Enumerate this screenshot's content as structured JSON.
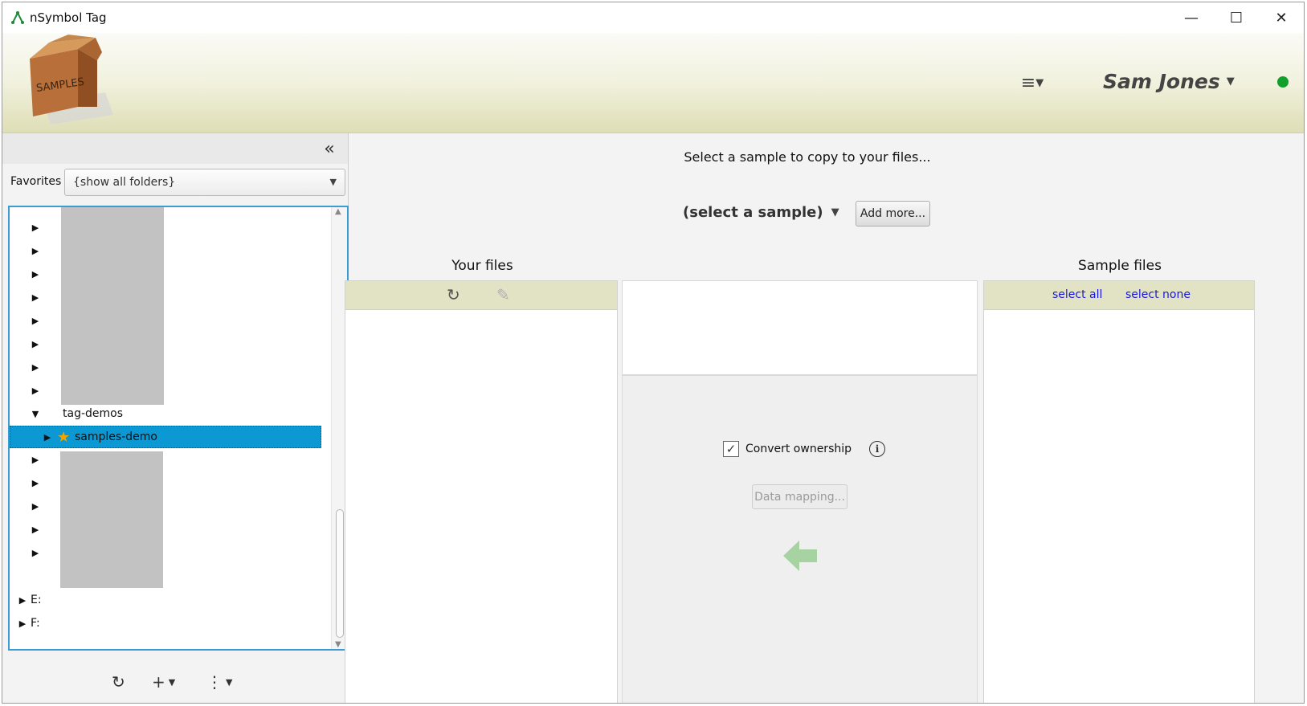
{
  "window": {
    "title": "nSymbol Tag",
    "minimize_glyph": "—",
    "maximize_glyph": "☐",
    "close_glyph": "✕"
  },
  "header": {
    "logo_text": "SAMPLES",
    "menu_glyph": "≡",
    "user_name": "Sam Jones",
    "status_color": "#12a02a"
  },
  "left_panel": {
    "collapse_glyph": "«",
    "favorites_label": "Favorites",
    "favorites_value": "{show all folders}",
    "tree": {
      "expanded_folder": "tag-demos",
      "selected_folder": "samples-demo",
      "drives": [
        "E:",
        "F:"
      ]
    },
    "bottom_toolbar": {
      "refresh_glyph": "↻",
      "add_glyph": "+",
      "more_glyph": "⋮"
    }
  },
  "main": {
    "prompt": "Select a sample to copy to your files...",
    "sample_select": "(select a sample)",
    "add_more_button": "Add more...",
    "your_files": {
      "title": "Your files",
      "refresh_glyph": "↻",
      "edit_glyph": "✎"
    },
    "sample_files": {
      "title": "Sample files",
      "select_all": "select all",
      "select_none": "select none"
    },
    "convert_ownership": {
      "label": "Convert ownership",
      "checked": true,
      "check_glyph": "✓",
      "info_glyph": "i"
    },
    "data_mapping_button": "Data mapping...",
    "accent_color": "#a7d3a3"
  }
}
